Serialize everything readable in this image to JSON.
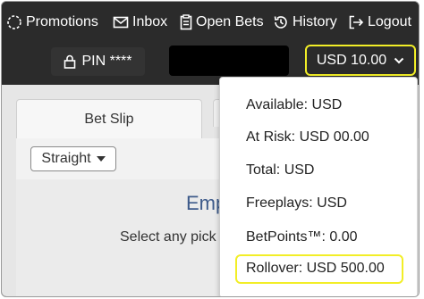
{
  "nav": {
    "items": [
      {
        "label": "Promotions",
        "icon": "promotions-icon"
      },
      {
        "label": "Inbox",
        "icon": "mail-icon"
      },
      {
        "label": "Open Bets",
        "icon": "clipboard-icon"
      },
      {
        "label": "History",
        "icon": "history-icon"
      },
      {
        "label": "Logout",
        "icon": "logout-icon"
      }
    ]
  },
  "account": {
    "pin_label": "PIN ****",
    "balance_label": "USD 10.00"
  },
  "betslip": {
    "tab_label": "Bet Slip",
    "bet_type": "Straight",
    "empty_title": "Emp",
    "empty_text": "Select any pick"
  },
  "balance_dropdown": {
    "items": [
      "Available: USD",
      "At Risk: USD 00.00",
      "Total: USD",
      "Freeplays: USD",
      "BetPoints™: 0.00",
      "Rollover: USD 500.00"
    ]
  },
  "colors": {
    "header_bg": "#2b2b2b",
    "highlight": "#f2ee27",
    "empty_title": "#3d5a8a"
  }
}
